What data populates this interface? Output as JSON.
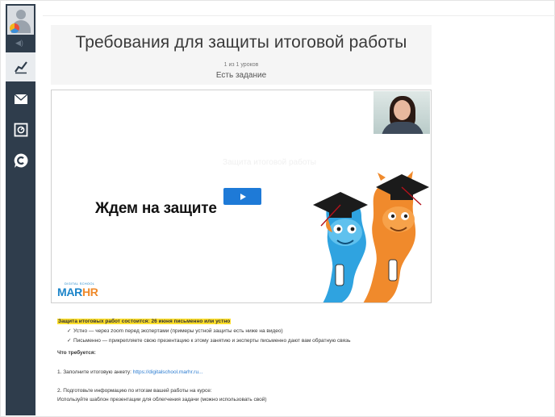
{
  "sidebar": {
    "items": [
      {
        "name": "stats",
        "icon": "chart-icon",
        "active": true
      },
      {
        "name": "messages",
        "icon": "envelope-icon",
        "active": false
      },
      {
        "name": "safe",
        "icon": "safe-icon",
        "active": false
      },
      {
        "name": "support",
        "icon": "chat-c-icon",
        "active": false
      }
    ]
  },
  "lesson": {
    "title": "Требования для защиты итоговой работы",
    "count": "1 из 1 уроков",
    "task": "Есть задание"
  },
  "video": {
    "headline": "Ждем на защите",
    "faint_text": "Защита итоговой работы",
    "logo_school": "DIGITAL SCHOOL",
    "logo_brand_a": "MAR",
    "logo_brand_b": "HR"
  },
  "content": {
    "highlight": "Защита итоговых работ состоится: 26 июня письменно или устно",
    "bullet_1": "Устно — через zoom перед экспертами (примеры устной защиты есть ниже на видео)",
    "bullet_2": "Письменно — прикрепляете свою презентацию к этому занятию и эксперты письменно дают вам обратную связь",
    "required_heading": "Что требуется:",
    "step_1_prefix": "1. Заполните итоговую анкету: ",
    "step_1_link": "https://digitalschool.marhr.ru...",
    "step_2": "2. Подготовьте информацию по итогам вашей работы на курсе:",
    "step_2_note": "Используйте шаблон презентации для облегчения задачи (можно использовать свой)",
    "check_mark": "✓"
  },
  "colors": {
    "sidebar_bg": "#2f3d4c",
    "highlight": "#ffdf2b",
    "play_button": "#1e7ad7",
    "link": "#2a7bd0",
    "brand_blue": "#1b84c9",
    "brand_orange": "#ef8a2b"
  }
}
